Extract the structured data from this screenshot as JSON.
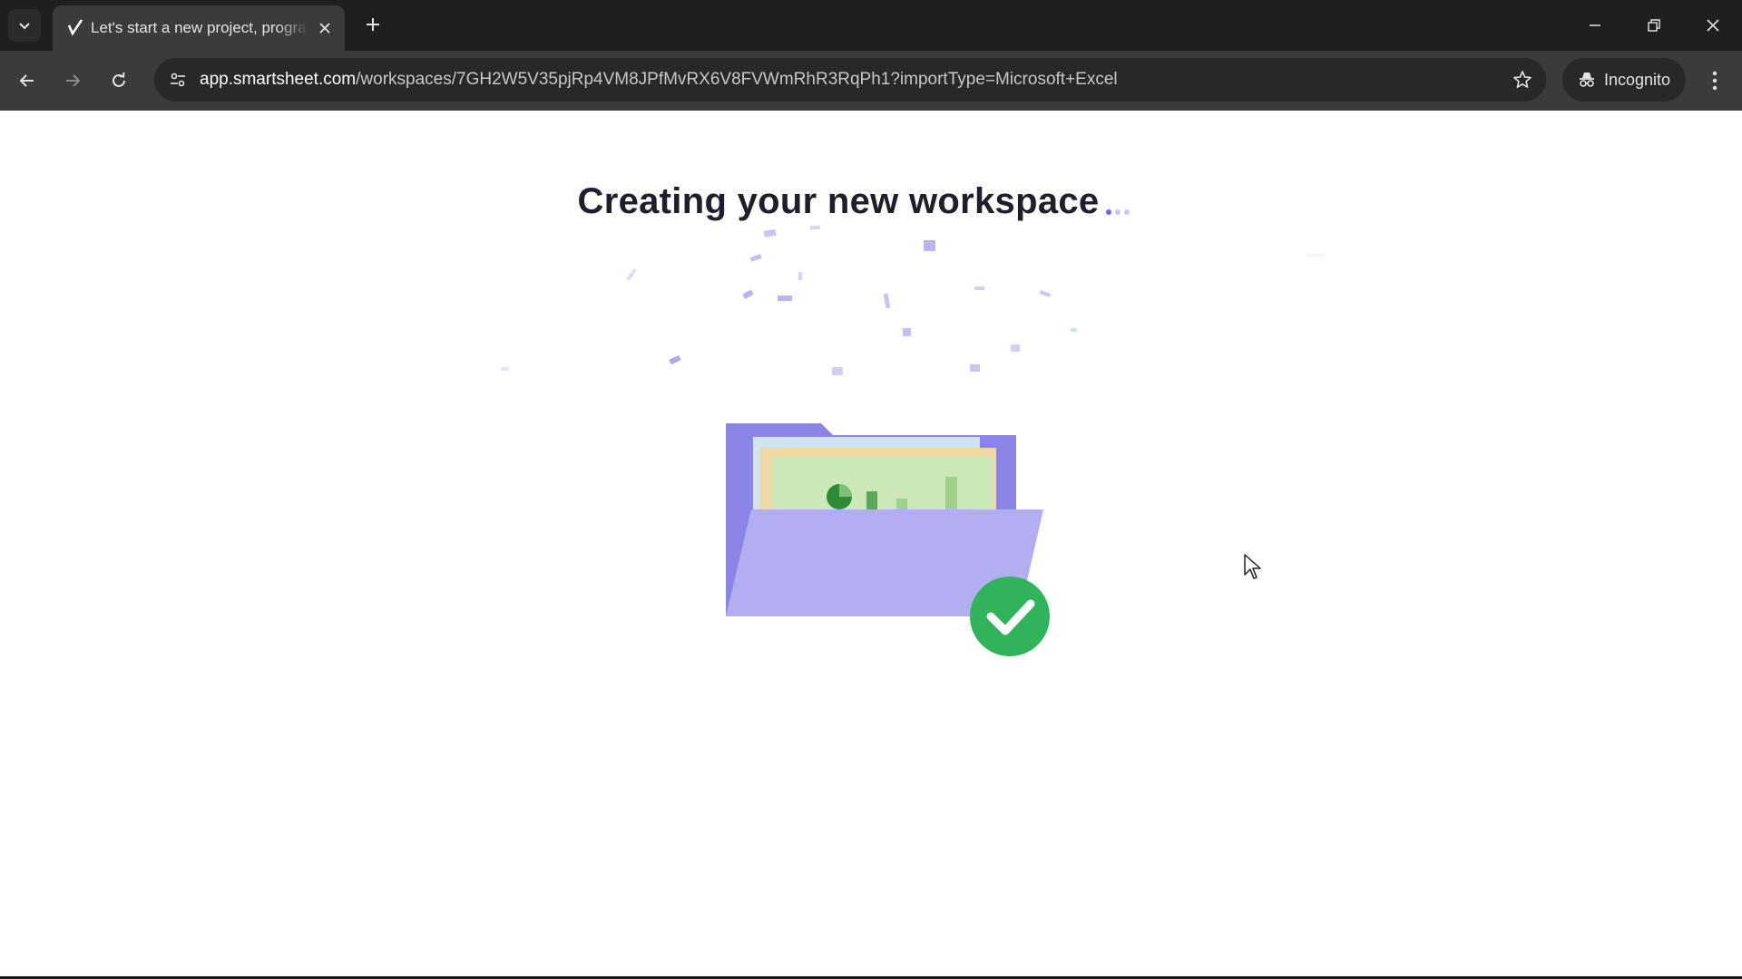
{
  "browser": {
    "tab": {
      "title": "Let's start a new project, program, or workflow",
      "favicon": "smartsheet-check-icon"
    },
    "address_bar": {
      "host": "app.smartsheet.com",
      "path": "/workspaces/7GH2W5V35pjRp4VM8JPfMvRX6V8FVWmRhR3RqPh1?importType=Microsoft+Excel"
    },
    "profile": {
      "label": "Incognito"
    }
  },
  "page": {
    "heading": "Creating your new workspace",
    "loading_dots": 3,
    "illustration": "folder-with-checkmark",
    "colors": {
      "folder": "#b3aef2",
      "folder_back": "#8a84e6",
      "check_badge": "#2fb45a",
      "confetti": "#9b95e8"
    }
  }
}
